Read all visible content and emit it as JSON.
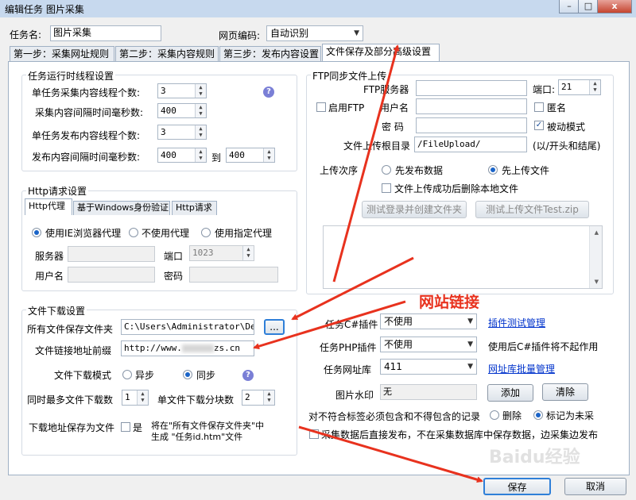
{
  "window": {
    "title": "编辑任务 图片采集",
    "controls": {
      "minimize": "–",
      "maximize": "□",
      "close": "x"
    }
  },
  "task": {
    "name_label": "任务名:",
    "name_value": "图片采集",
    "encoding_label": "网页编码:",
    "encoding_value": "自动识别"
  },
  "tabs": [
    {
      "label": "第一步：采集网址规则"
    },
    {
      "label": "第二步：采集内容规则"
    },
    {
      "label": "第三步：发布内容设置"
    },
    {
      "label": "文件保存及部分高级设置"
    }
  ],
  "thread_settings": {
    "title": "任务运行时线程设置",
    "collect_threads_label": "单任务采集内容线程个数:",
    "collect_threads": "3",
    "collect_interval_label": "采集内容间隔时间毫秒数:",
    "collect_interval": "400",
    "publish_threads_label": "单任务发布内容线程个数:",
    "publish_threads": "3",
    "publish_interval_label": "发布内容间隔时间毫秒数:",
    "publish_interval_from": "400",
    "to_label": "到",
    "publish_interval_to": "400",
    "help": "?"
  },
  "http": {
    "title": "Http请求设置",
    "tabs": [
      {
        "label": "Http代理"
      },
      {
        "label": "基于Windows身份验证"
      },
      {
        "label": "Http请求"
      }
    ],
    "proxy_ie": "使用IE浏览器代理",
    "proxy_none": "不使用代理",
    "proxy_custom": "使用指定代理",
    "server_label": "服务器",
    "port_label": "端口",
    "port_value": "1023",
    "user_label": "用户名",
    "password_label": "密码"
  },
  "download": {
    "title": "文件下载设置",
    "save_folder_label": "所有文件保存文件夹",
    "save_folder_value": "C:\\Users\\Administrator\\Desk",
    "browse": "...",
    "prefix_label": "文件链接地址前缀",
    "prefix_value_a": "http://www.",
    "prefix_value_b": "zs.cn",
    "mode_label": "文件下载模式",
    "mode_async": "异步",
    "mode_sync": "同步",
    "max_downloads_label": "同时最多文件下载数",
    "max_downloads": "1",
    "blocks_label": "单文件下载分块数",
    "blocks": "2",
    "save_as_label": "下载地址保存为文件",
    "save_as_yes": "是",
    "save_as_note_1": "将在\"所有文件保存文件夹\"中",
    "save_as_note_2": "生成 \"任务id.htm\"文件",
    "help": "?"
  },
  "ftp": {
    "title": "FTP同步文件上传",
    "enable_label": "启用FTP",
    "server_label": "FTP服务器",
    "port_label": "端口:",
    "port_value": "21",
    "user_label": "用户名",
    "anonymous_label": "匿名",
    "password_label": "密  码",
    "passive_label": "被动模式",
    "root_label": "文件上传根目录",
    "root_value": "/FileUpload/",
    "root_hint": "(以/开头和结尾)",
    "order_label": "上传次序",
    "order_publish_first": "先发布数据",
    "order_upload_first": "先上传文件",
    "delete_after_label": "文件上传成功后删除本地文件",
    "test_login_button": "测试登录并创建文件夹",
    "test_upload_button": "测试上传文件Test.zip"
  },
  "plugins": {
    "csharp_label": "任务C#插件",
    "csharp_value": "不使用",
    "csharp_link": "插件测试管理",
    "php_label": "任务PHP插件",
    "php_value": "不使用",
    "php_note": "使用后C#插件将不起作用",
    "urlset_label": "任务网址库",
    "urlset_value": "411",
    "urlset_link": "网址库批量管理",
    "watermark_label": "图片水印",
    "watermark_value": "无",
    "add_button": "添加",
    "clear_button": "清除"
  },
  "records": {
    "label": "对不符合标签必须包含和不得包含的记录",
    "delete": "删除",
    "mark": "标记为未采",
    "direct_publish": "采集数据后直接发布，不在采集数据库中保存数据，边采集边发布"
  },
  "footer": {
    "save_button": "保存",
    "cancel_button": "取消"
  },
  "annotation": {
    "text": "网站链接",
    "color": "#e8321e"
  },
  "watermark_text": "Baidu经验"
}
